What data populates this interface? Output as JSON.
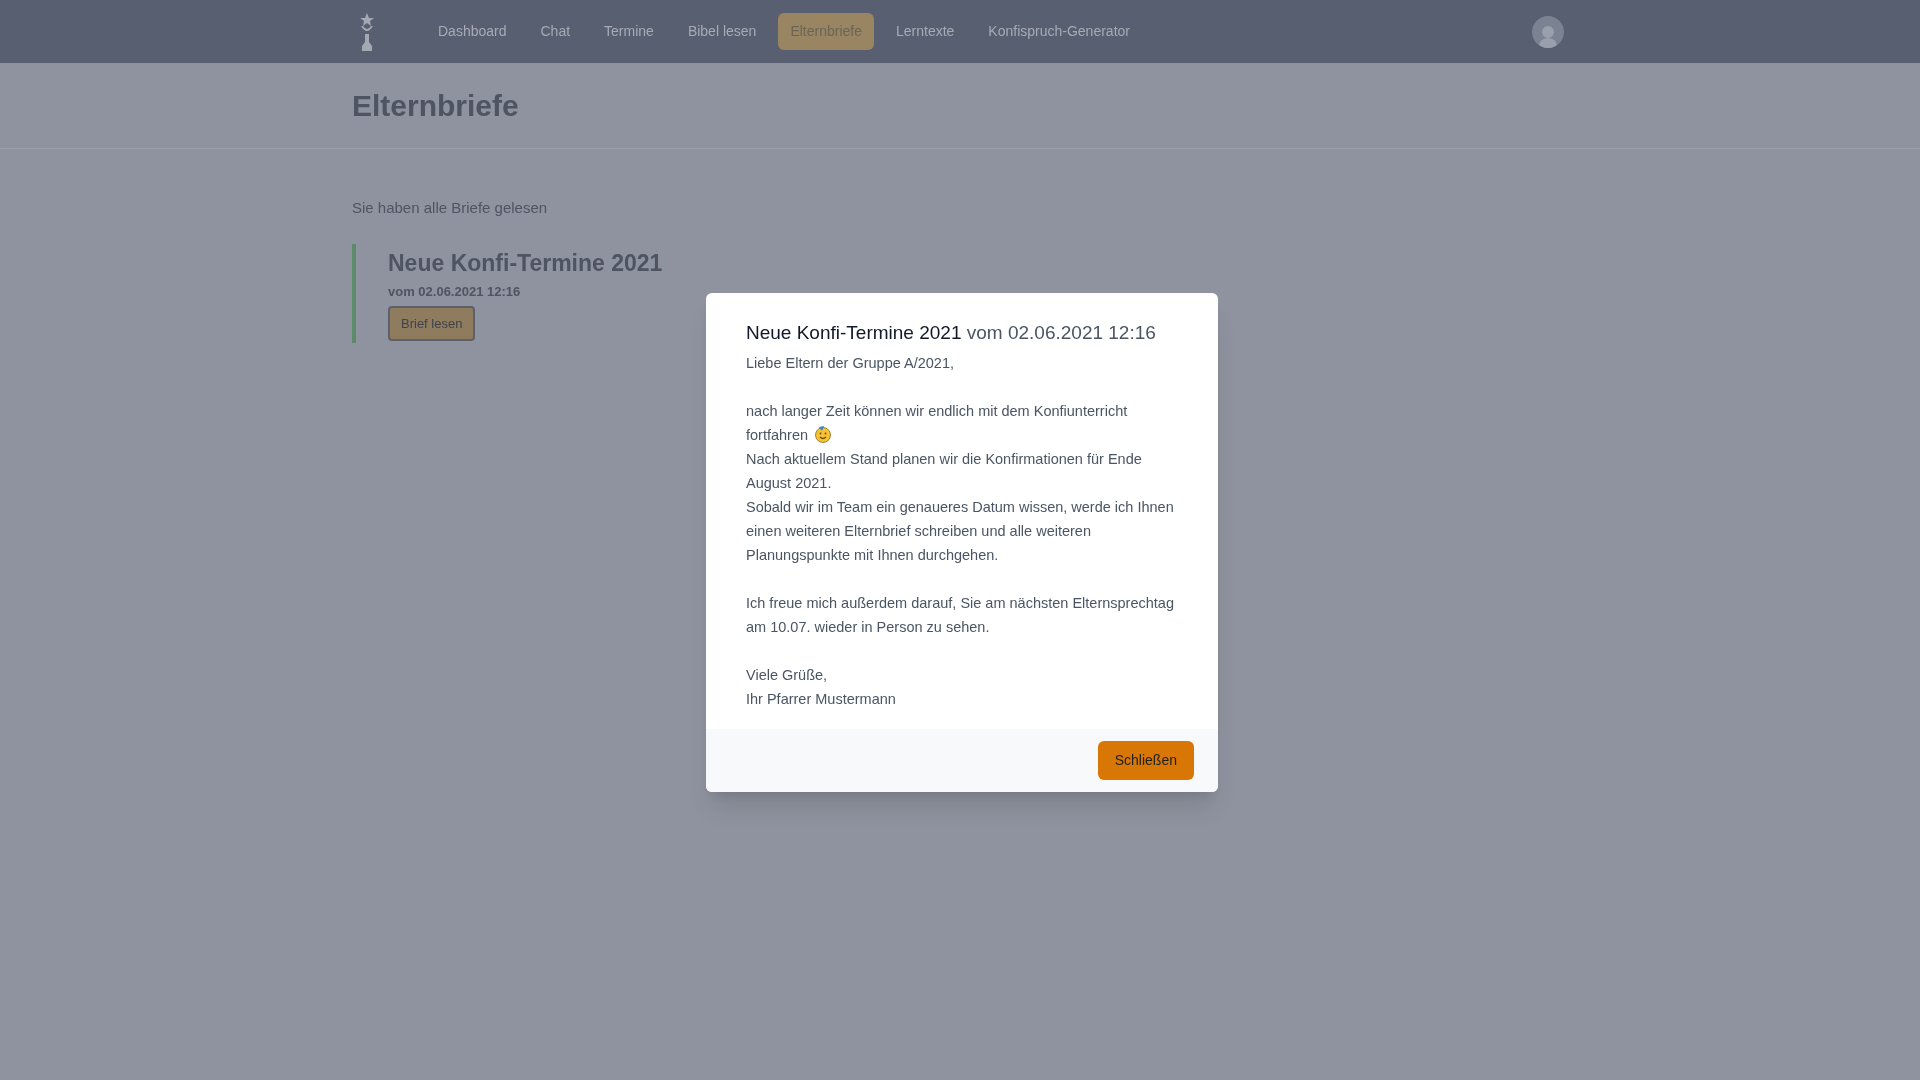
{
  "nav": {
    "items": [
      {
        "label": "Dashboard",
        "selected": false
      },
      {
        "label": "Chat",
        "selected": false
      },
      {
        "label": "Termine",
        "selected": false
      },
      {
        "label": "Bibel lesen",
        "selected": false
      },
      {
        "label": "Elternbriefe",
        "selected": true
      },
      {
        "label": "Lerntexte",
        "selected": false
      },
      {
        "label": "Konfispruch-Generator",
        "selected": false
      }
    ]
  },
  "page": {
    "title": "Elternbriefe",
    "status": "Sie haben alle Briefe gelesen",
    "letters": [
      {
        "title": "Neue Konfi-Termine 2021",
        "date": "vom 02.06.2021 12:16",
        "button": "Brief lesen"
      }
    ]
  },
  "modal": {
    "title": "Neue Konfi-Termine 2021",
    "date": "vom 02.06.2021 12:16",
    "paragraphs": [
      [
        {
          "text": "Liebe Eltern der Gruppe A/2021,",
          "emoji": false
        }
      ],
      [
        {
          "text": "nach langer Zeit können wir endlich mit dem Konfiunterricht fortfahren",
          "emoji": true
        },
        {
          "text": "Nach aktuellem Stand planen wir die Konfirmationen für Ende August 2021.",
          "emoji": false
        },
        {
          "text": "Sobald wir im Team ein genaueres Datum wissen, werde ich Ihnen einen weiteren Elternbrief schreiben und alle weiteren Planungspunkte mit Ihnen durchgehen.",
          "emoji": false
        }
      ],
      [
        {
          "text": "Ich freue mich außerdem darauf, Sie am nächsten Elternsprechtag am 10.07. wieder in Person zu sehen.",
          "emoji": false
        }
      ],
      [
        {
          "text": "Viele Grüße,",
          "emoji": false
        },
        {
          "text": "Ihr Pfarrer Mustermann",
          "emoji": false
        }
      ]
    ],
    "close_button": "Schließen"
  }
}
